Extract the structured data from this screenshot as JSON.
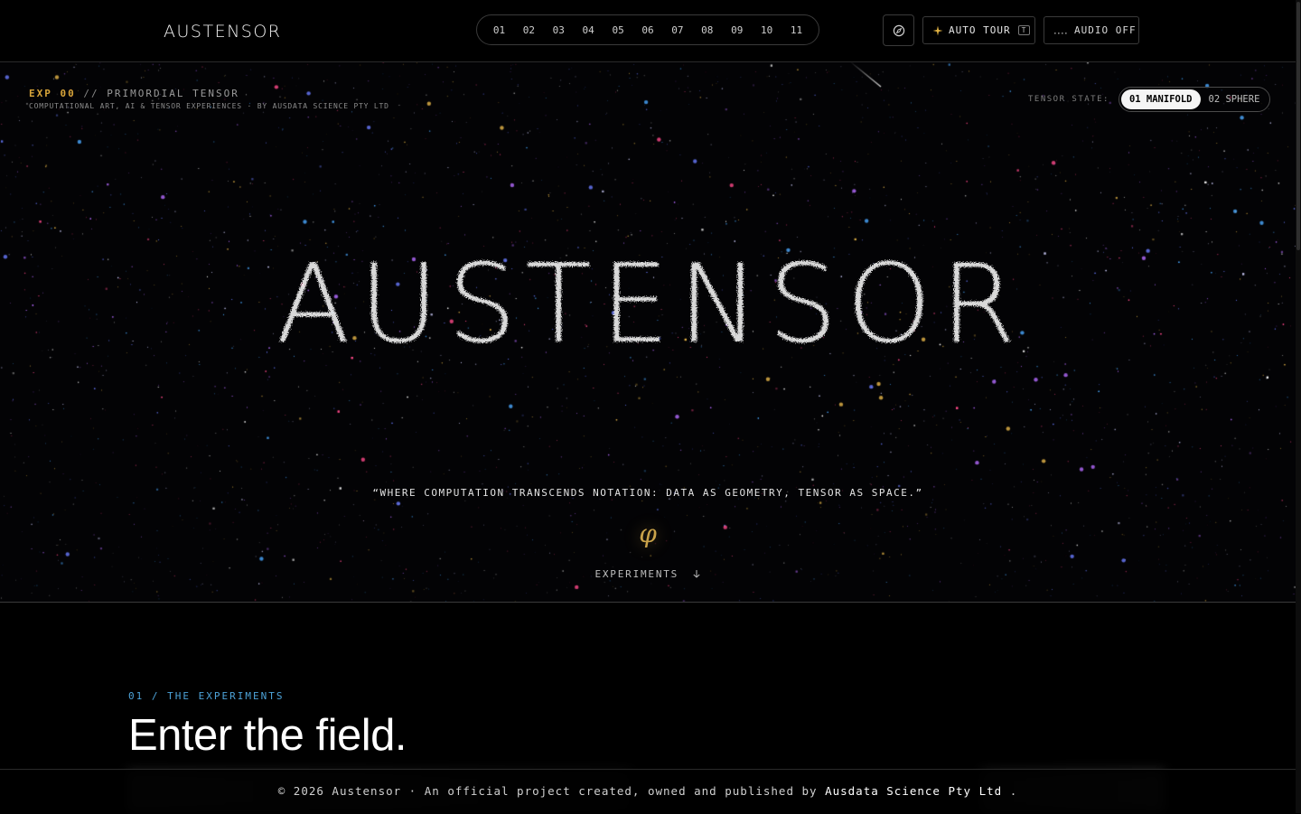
{
  "header": {
    "brand": "AUSTENSOR",
    "experiments": [
      "01",
      "02",
      "03",
      "04",
      "05",
      "06",
      "07",
      "08",
      "09",
      "10",
      "11"
    ],
    "compass_icon": "compass-icon",
    "auto_tour": {
      "icon": "sparkle-icon",
      "label": "AUTO TOUR",
      "key": "T"
    },
    "audio": {
      "icon": "audio-dots-icon",
      "label": "AUDIO OFF"
    }
  },
  "hero": {
    "exp_code": "EXP 00",
    "exp_sep": "//",
    "exp_name": "PRIMORDIAL TENSOR",
    "subtitle": "COMPUTATIONAL ART, AI & TENSOR EXPERIENCES · BY AUSDATA SCIENCE PTY LTD",
    "tensor_state_label": "TENSOR STATE:",
    "tensor_states": [
      {
        "label": "01 MANIFOLD",
        "active": true
      },
      {
        "label": "02 SPHERE",
        "active": false
      }
    ],
    "particle_word": "AUSTENSOR",
    "quote": "“WHERE COMPUTATION TRANSCENDS NOTATION: DATA AS GEOMETRY, TENSOR AS SPACE.”",
    "symbol": "φ",
    "cta": "EXPERIMENTS",
    "cta_icon": "arrow-down-icon"
  },
  "experiments_section": {
    "eyebrow": "01 / THE EXPERIMENTS",
    "title": "Enter the field."
  },
  "footer": {
    "prefix": "© 2026 Austensor · An official project created, owned and published by",
    "org": "Ausdata Science Pty Ltd",
    "suffix": "."
  },
  "colors": {
    "background": "#000000",
    "accent_gold": "#d9a53a",
    "accent_blue": "#4da3d9",
    "text": "#e3e3e3"
  }
}
